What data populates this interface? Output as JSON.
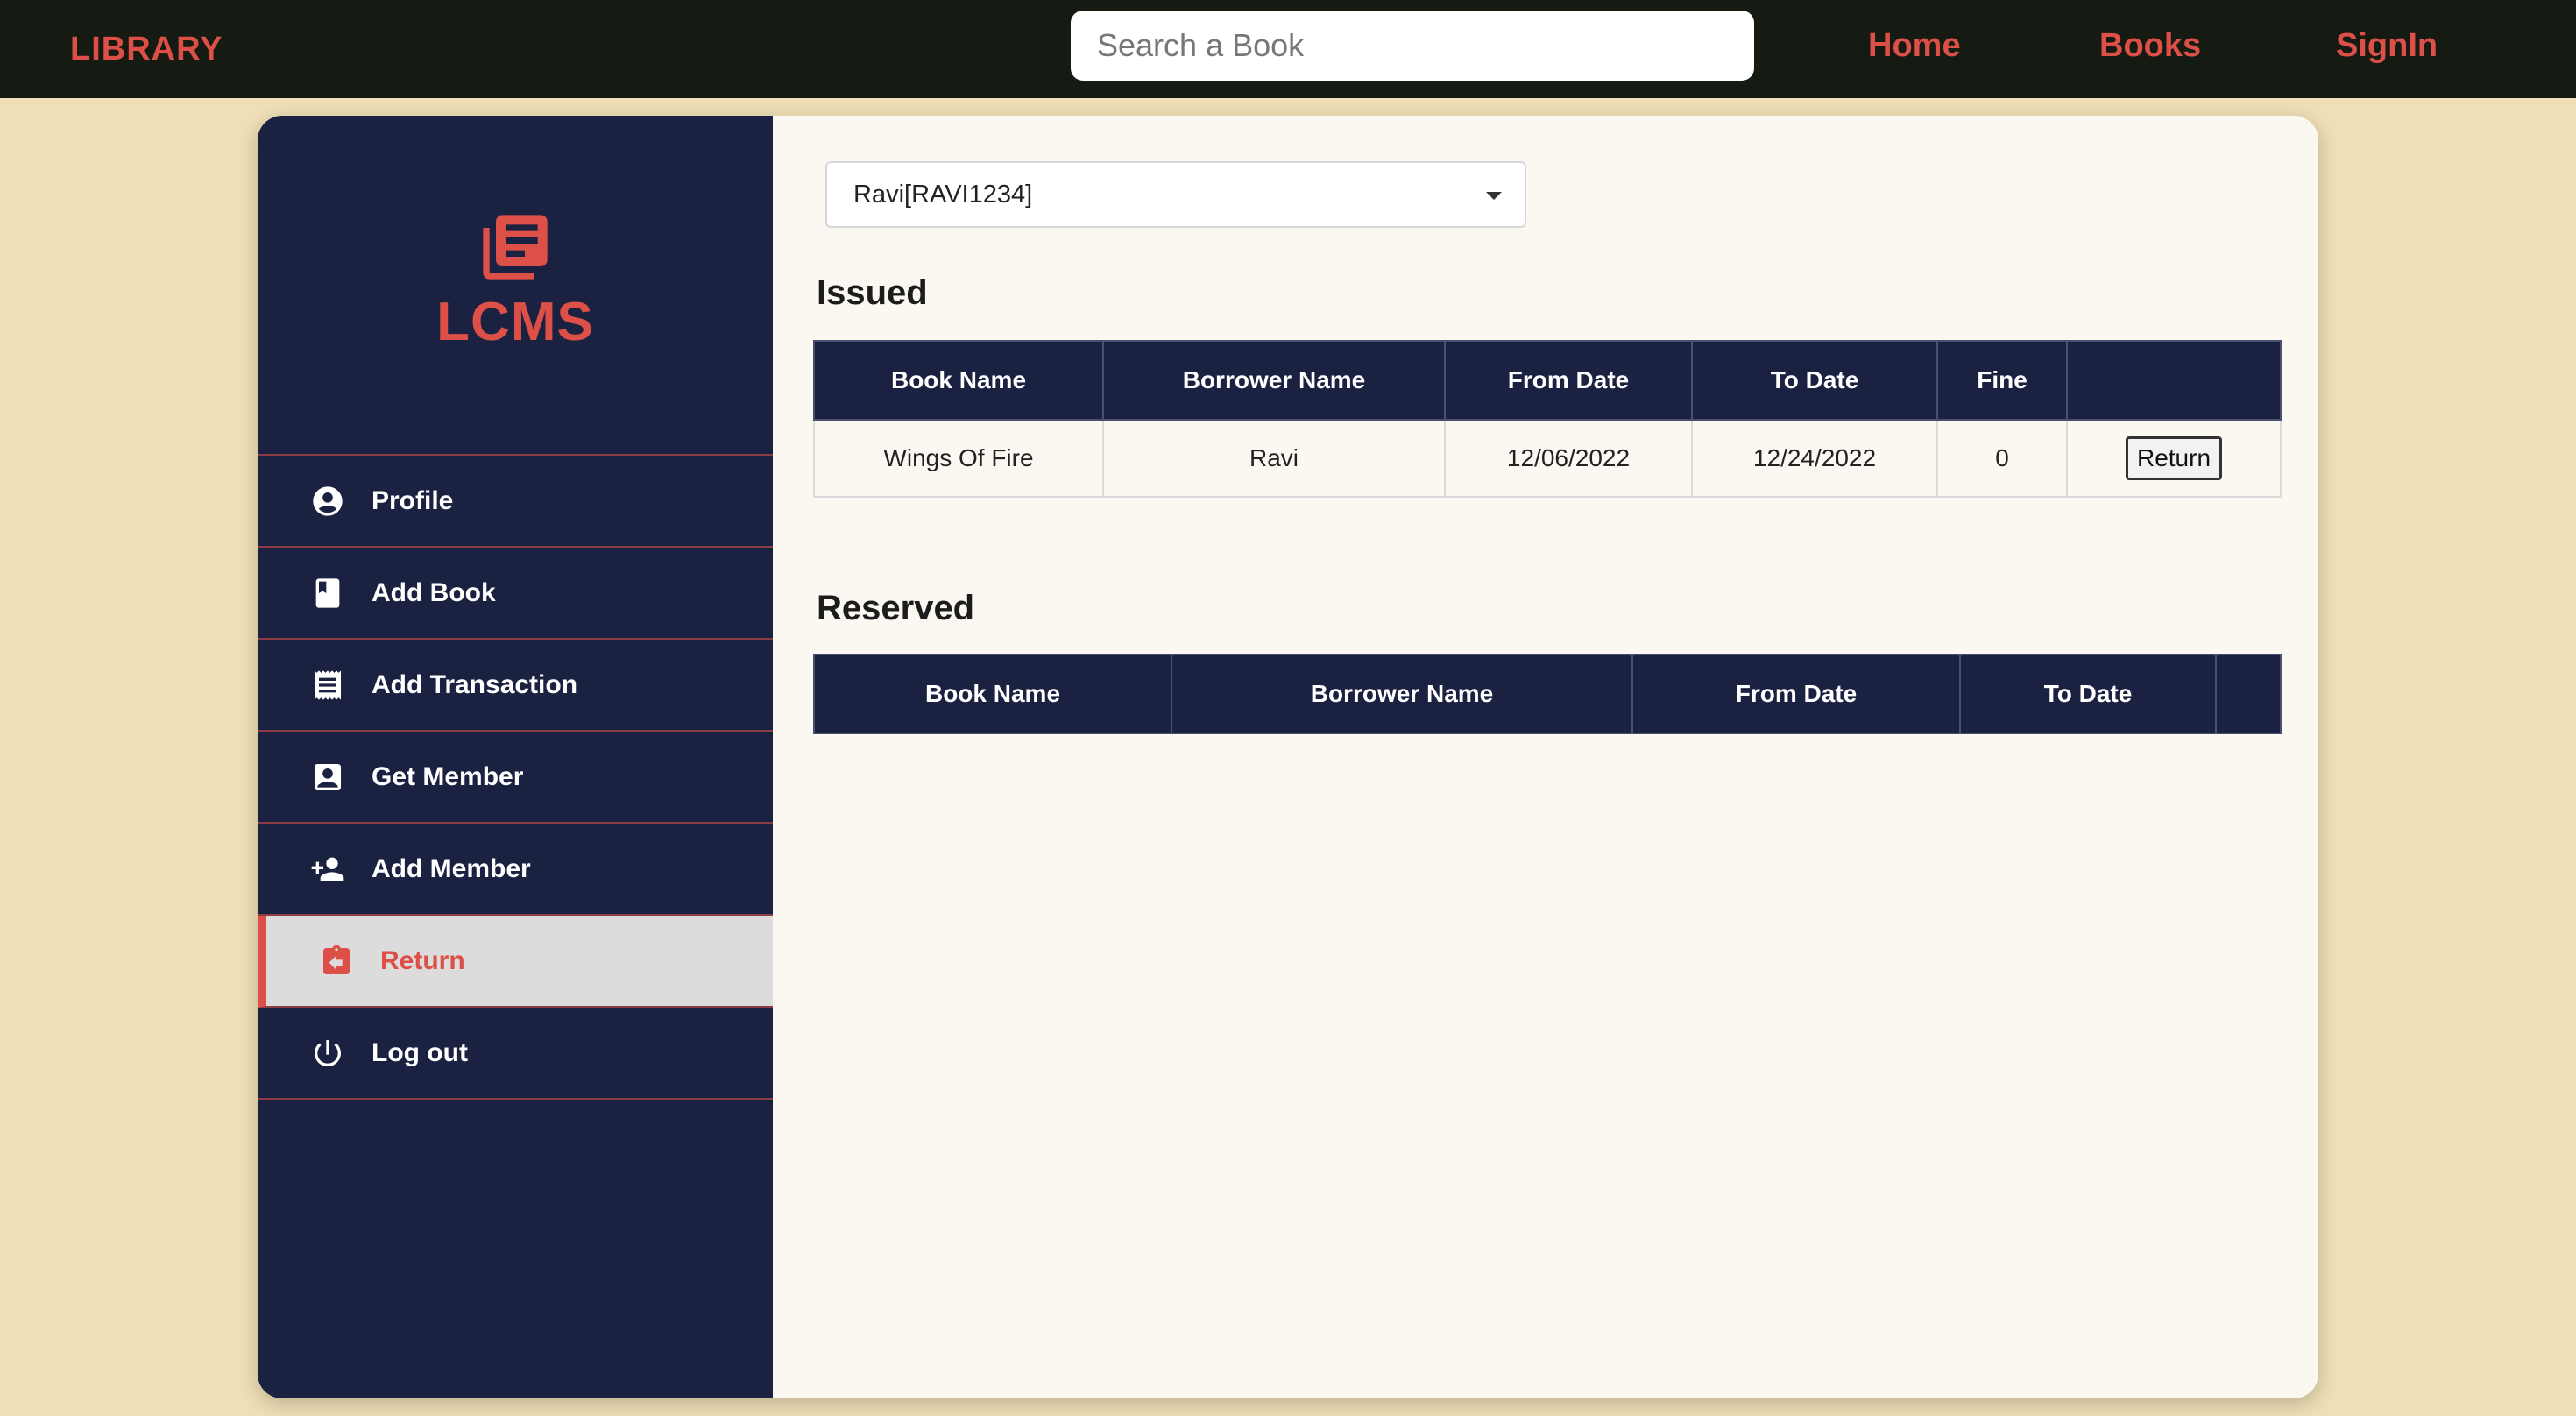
{
  "navbar": {
    "brand": "LIBRARY",
    "search_placeholder": "Search a Book",
    "links": {
      "home": "Home",
      "books": "Books",
      "signin": "SignIn"
    }
  },
  "sidebar": {
    "logo_icon": "library-books-icon",
    "logo_text": "LCMS",
    "items": [
      {
        "label": "Profile",
        "icon": "account-circle-icon"
      },
      {
        "label": "Add Book",
        "icon": "book-icon"
      },
      {
        "label": "Add Transaction",
        "icon": "receipt-icon"
      },
      {
        "label": "Get Member",
        "icon": "contact-card-icon"
      },
      {
        "label": "Add Member",
        "icon": "person-add-icon"
      },
      {
        "label": "Return",
        "icon": "assignment-return-icon",
        "active": true
      },
      {
        "label": "Log out",
        "icon": "power-icon"
      }
    ]
  },
  "main": {
    "member_select": {
      "value": "Ravi[RAVI1234]"
    },
    "issued": {
      "title": "Issued",
      "headers": [
        "Book Name",
        "Borrower Name",
        "From Date",
        "To Date",
        "Fine",
        ""
      ],
      "rows": [
        {
          "book": "Wings Of Fire",
          "borrower": "Ravi",
          "from": "12/06/2022",
          "to": "12/24/2022",
          "fine": "0",
          "action": "Return"
        }
      ]
    },
    "reserved": {
      "title": "Reserved",
      "headers": [
        "Book Name",
        "Borrower Name",
        "From Date",
        "To Date",
        ""
      ],
      "rows": []
    }
  },
  "colors": {
    "accent": "#dd5048",
    "navbar_bg": "#151a12",
    "sidebar_bg": "#1b2140",
    "page_bg": "#f0dfb6",
    "content_bg": "#fbf7f1",
    "active_item_bg": "#dcdcdc"
  }
}
